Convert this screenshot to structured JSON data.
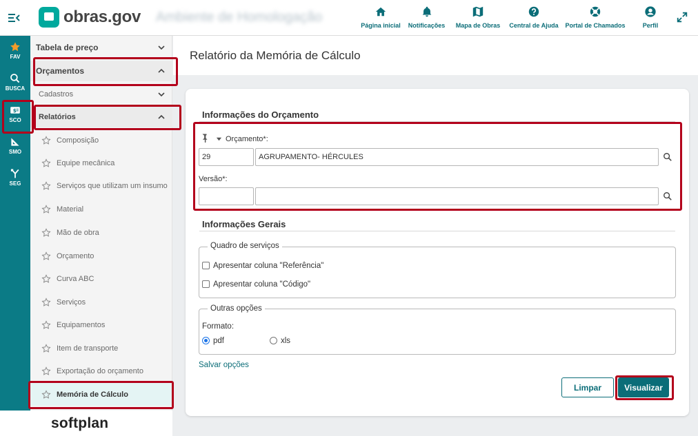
{
  "header": {
    "logo_text": "obras.gov",
    "environment": "Ambiente de Homologação",
    "nav": [
      {
        "label": "Página inicial",
        "icon": "home-icon"
      },
      {
        "label": "Notificações",
        "icon": "bell-icon"
      },
      {
        "label": "Mapa de Obras",
        "icon": "map-icon"
      },
      {
        "label": "Central de Ajuda",
        "icon": "help-icon"
      },
      {
        "label": "Portal de Chamados",
        "icon": "lifebuoy-icon"
      },
      {
        "label": "Perfil",
        "icon": "user-icon"
      }
    ]
  },
  "rail": {
    "items": [
      {
        "label": "FAV",
        "icon": "star-icon"
      },
      {
        "label": "BUSCA",
        "icon": "search-icon"
      },
      {
        "label": "SCO",
        "icon": "money-icon"
      },
      {
        "label": "SMO",
        "icon": "ruler-icon"
      },
      {
        "label": "SEG",
        "icon": "merge-icon"
      }
    ]
  },
  "sidebar": {
    "tabela_preco": "Tabela de preço",
    "orcamentos": "Orçamentos",
    "cadastros": "Cadastros",
    "relatorios": "Relatórios",
    "items": [
      "Composição",
      "Equipe mecânica",
      "Serviços que utilizam um insumo",
      "Material",
      "Mão de obra",
      "Orçamento",
      "Curva ABC",
      "Serviços",
      "Equipamentos",
      "Item de transporte",
      "Exportação do orçamento",
      "Memória de Cálculo"
    ],
    "footer_brand": "softplan"
  },
  "page": {
    "title": "Relatório da Memória de Cálculo"
  },
  "form": {
    "orcamento_section": "Informações do Orçamento",
    "orcamento_label": "Orçamento*:",
    "orcamento_code": "29",
    "orcamento_desc": "AGRUPAMENTO- HÉRCULES",
    "versao_label": "Versão*:",
    "versao_code": "",
    "versao_desc": "",
    "gerais_section": "Informações Gerais",
    "quadro_legend": "Quadro de serviços",
    "opt_referencia": "Apresentar coluna \"Referência\"",
    "opt_codigo": "Apresentar coluna \"Código\"",
    "outras_legend": "Outras opções",
    "formato_label": "Formato:",
    "formato_pdf": "pdf",
    "formato_xls": "xls",
    "formato_selected": "pdf",
    "salvar_link": "Salvar opções",
    "btn_limpar": "Limpar",
    "btn_visualizar": "Visualizar"
  },
  "colors": {
    "brand": "#0b6d78",
    "rail": "#0b7b86",
    "logo": "#00a99d",
    "highlight": "#b3001b"
  }
}
